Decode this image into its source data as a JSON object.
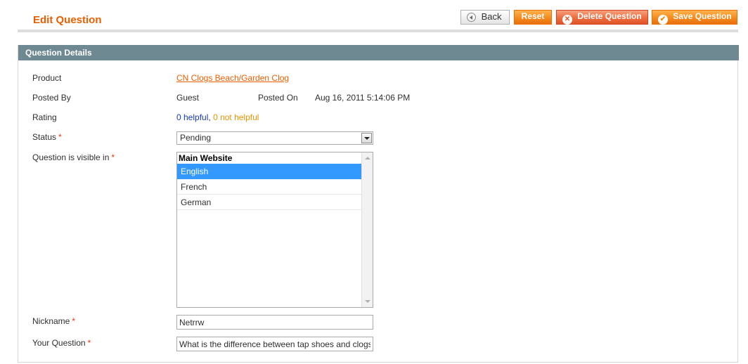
{
  "header": {
    "title": "Edit Question",
    "buttons": {
      "back": "Back",
      "reset": "Reset",
      "delete": "Delete Question",
      "save": "Save Question"
    }
  },
  "section": {
    "title": "Question Details"
  },
  "fields": {
    "product": {
      "label": "Product",
      "value": "CN Clogs Beach/Garden Clog"
    },
    "posted_by": {
      "label": "Posted By",
      "value": "Guest"
    },
    "posted_on": {
      "label": "Posted On",
      "value": "Aug 16, 2011 5:14:06 PM"
    },
    "rating": {
      "label": "Rating",
      "helpful": "0 helpful",
      "separator": ",",
      "not_helpful": "0 not helpful"
    },
    "status": {
      "label": "Status",
      "required": "*",
      "value": "Pending"
    },
    "visible_in": {
      "label": "Question is visible in",
      "required": "*",
      "group": "Main Website",
      "options": [
        "English",
        "French",
        "German"
      ],
      "selected": "English"
    },
    "nickname": {
      "label": "Nickname",
      "required": "*",
      "value": "Netrrw"
    },
    "question": {
      "label": "Your Question",
      "required": "*",
      "value": "What is the difference between tap shoes and clogs?"
    }
  },
  "colors": {
    "accent": "#eb5e00",
    "section_bar": "#6f8992",
    "selected_option": "#3399ff",
    "helpful_link": "#1a3ab8",
    "not_helpful_link": "#eb9300"
  }
}
